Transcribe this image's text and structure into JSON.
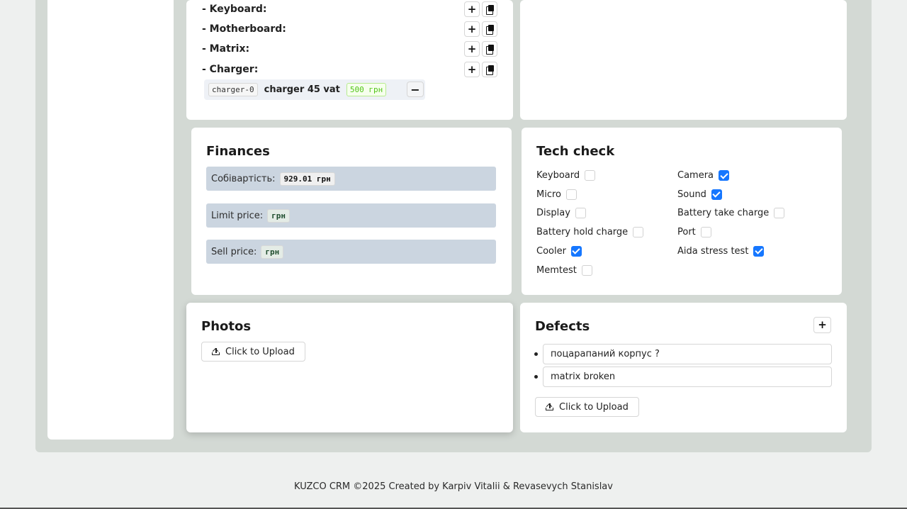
{
  "parts": {
    "rows": [
      {
        "label": "- Keyboard:"
      },
      {
        "label": "- Motherboard:"
      },
      {
        "label": "- Matrix:"
      },
      {
        "label": "- Charger:"
      }
    ],
    "add_glyph": "+",
    "charger_item": {
      "code": "charger-0",
      "name": "charger 45 vat",
      "price": "500 грн",
      "remove_glyph": "−"
    }
  },
  "finances": {
    "title": "Finances",
    "cost_label": "Собівартість:",
    "cost_value": "929.01 грн",
    "limit_label": "Limit price:",
    "limit_value": "грн",
    "sell_label": "Sell price:",
    "sell_value": "грн"
  },
  "tech_check": {
    "title": "Tech check",
    "items": [
      {
        "label": "Keyboard",
        "checked": false
      },
      {
        "label": "Camera",
        "checked": true
      },
      {
        "label": "Micro",
        "checked": false
      },
      {
        "label": "Sound",
        "checked": true
      },
      {
        "label": "Display",
        "checked": false
      },
      {
        "label": "Battery take charge",
        "checked": false
      },
      {
        "label": "Battery hold charge",
        "checked": false
      },
      {
        "label": "Port",
        "checked": false
      },
      {
        "label": "Cooler",
        "checked": true
      },
      {
        "label": "Aida stress test",
        "checked": true
      },
      {
        "label": "Memtest",
        "checked": false
      }
    ]
  },
  "photos": {
    "title": "Photos",
    "upload_label": "Click to Upload"
  },
  "defects": {
    "title": "Defects",
    "add_glyph": "+",
    "items": [
      "поцарапаний корпус ?",
      "matrix broken"
    ],
    "upload_label": "Click to Upload"
  },
  "footer": {
    "text": "KUZCO CRM ©2025 Created by Karpiv Vitalii & Revasevych Stanislav"
  },
  "colors": {
    "accent": "#1677ff",
    "finance_row_bg": "#cbd5e0",
    "frame_bg": "#d3d9d4"
  }
}
